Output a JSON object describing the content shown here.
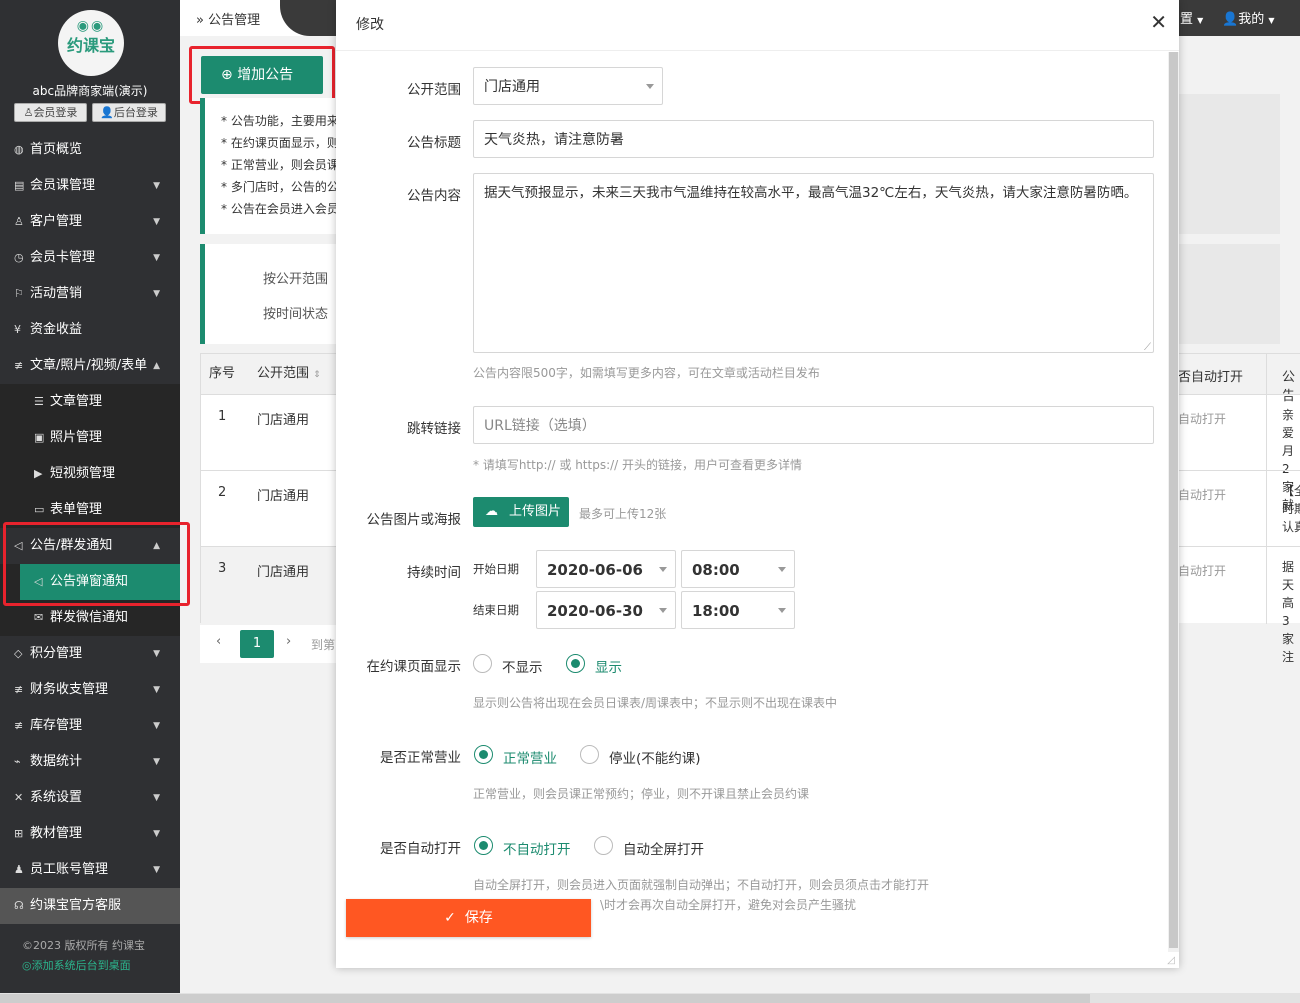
{
  "sidebar": {
    "logo_eyes": "◉◉",
    "logo_text": "约课宝",
    "brand": "abc品牌商家端(演示)",
    "member_login": "会员登录",
    "admin_login": "后台登录",
    "items": [
      {
        "label": "首页概览",
        "icon": "globe-icon"
      },
      {
        "label": "会员课管理",
        "icon": "document-icon"
      },
      {
        "label": "客户管理",
        "icon": "user-icon"
      },
      {
        "label": "会员卡管理",
        "icon": "clock-icon"
      },
      {
        "label": "活动营销",
        "icon": "flag-icon"
      },
      {
        "label": "资金收益",
        "icon": "yen-icon"
      },
      {
        "label": "文章/照片/视频/表单",
        "icon": "sliders-icon"
      }
    ],
    "sub_articles": [
      {
        "label": "文章管理"
      },
      {
        "label": "照片管理"
      },
      {
        "label": "短视频管理"
      },
      {
        "label": "表单管理"
      }
    ],
    "notice_group": "公告/群发通知",
    "sub_notice": [
      {
        "label": "公告弹窗通知"
      },
      {
        "label": "群发微信通知"
      }
    ],
    "items2": [
      {
        "label": "积分管理"
      },
      {
        "label": "财务收支管理"
      },
      {
        "label": "库存管理"
      },
      {
        "label": "数据统计"
      },
      {
        "label": "系统设置"
      },
      {
        "label": "教材管理"
      },
      {
        "label": "员工账号管理"
      }
    ],
    "service": "约课宝官方客服",
    "copyright": "©2023 版权所有 约课宝",
    "desktop_link": "添加系统后台到桌面"
  },
  "header": {
    "breadcrumb": "公告管理",
    "settings_partial": "置",
    "mine": "我的"
  },
  "page": {
    "add_button": "增加公告",
    "tips": [
      "* 公告功能，主要用来",
      "* 在约课页面显示，则",
      "* 正常营业，则会员课",
      "* 多门店时，公告的公",
      "* 公告在会员进入会员"
    ],
    "filter_scope": "按公开范围",
    "filter_time": "按时间状态",
    "table": {
      "col_no": "序号",
      "col_scope": "公开范围",
      "col_auto": "否自动打开",
      "col_content": "公告",
      "rows": [
        {
          "no": "1",
          "scope": "门店通用",
          "auto": "自动打开",
          "c1": "亲爱",
          "c2": "月2",
          "c3": "家就"
        },
        {
          "no": "2",
          "scope": "门店通用",
          "auto": "自动打开",
          "c1": "【全",
          "c2": "时期",
          "c3": "认真"
        },
        {
          "no": "3",
          "scope": "门店通用",
          "auto": "自动打开",
          "c1": "据天",
          "c2": "高3",
          "c3": "家注"
        }
      ]
    },
    "pager": {
      "current": "1",
      "goto": "到第"
    }
  },
  "modal": {
    "title": "修改",
    "scope_label": "公开范围",
    "scope_value": "门店通用",
    "title_label": "公告标题",
    "title_value": "天气炎热，请注意防暑",
    "content_label": "公告内容",
    "content_value": "据天气预报显示，未来三天我市气温维持在较高水平，最高气温32℃左右，天气炎热，请大家注意防暑防晒。",
    "content_hint": "公告内容限500字，如需填写更多内容，可在文章或活动栏目发布",
    "link_label": "跳转链接",
    "link_placeholder": "URL链接（选填）",
    "link_hint": "* 请填写http:// 或 https:// 开头的链接，用户可查看更多详情",
    "image_label": "公告图片或海报",
    "upload_button": "上传图片",
    "upload_hint": "最多可上传12张",
    "duration_label": "持续时间",
    "start_label": "开始日期",
    "start_date": "2020-06-06",
    "start_time": "08:00",
    "end_label": "结束日期",
    "end_date": "2020-06-30",
    "end_time": "18:00",
    "show_label": "在约课页面显示",
    "show_off": "不显示",
    "show_on": "显示",
    "show_hint": "显示则公告将出现在会员日课表/周课表中；不显示则不出现在课表中",
    "business_label": "是否正常营业",
    "business_on": "正常营业",
    "business_off": "停业(不能约课)",
    "business_hint": "正常营业，则会员课正常预约；停业，则不开课且禁止会员约课",
    "auto_label": "是否自动打开",
    "auto_off": "不自动打开",
    "auto_on": "自动全屏打开",
    "auto_hint1": "自动全屏打开，则会员进入页面就强制自动弹出；不自动打开，则会员须点击才能打开",
    "auto_hint2": "\\时才会再次自动全屏打开，避免对会员产生骚扰",
    "save": "保存"
  },
  "colors": {
    "accent": "#1c8b6f",
    "save": "#ff5722",
    "highlight_box": "#e8232d",
    "sidebar": "#2f3033"
  }
}
